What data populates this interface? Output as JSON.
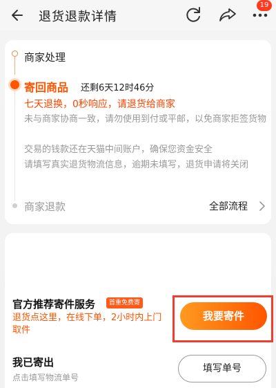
{
  "header": {
    "title": "退货退款详情",
    "badge_count": "19"
  },
  "progress": {
    "step_merchant_handle": "商家处理",
    "step_return_goods": "寄回商品",
    "countdown": "还剩6天12时46分",
    "policy": "七天退换，0秒响应，请退货给商家",
    "note_payment": "未与商家协商一致，请勿使用到付或平邮，以免商家拒签货物",
    "note_safety": "交易的钱款还在天猫中间账户，确保您资金安全",
    "note_fill": "请填写真实退货物流信息，逾期未填写，退货申请将关闭",
    "step_merchant_refund": "商家退款",
    "all_flow": "全部流程"
  },
  "shipping": {
    "service_title": "官方推荐寄件服务",
    "service_tag": "首重免费寄",
    "service_desc": "退货点这里，在线下单，2小时内上门取件",
    "send_button": "我要寄件",
    "sent_title": "我已寄出",
    "sent_hint": "点击填写物流单号",
    "fill_button": "填写单号"
  },
  "colors": {
    "accent": "#ff5500",
    "highlight_border": "#f23c2d"
  }
}
